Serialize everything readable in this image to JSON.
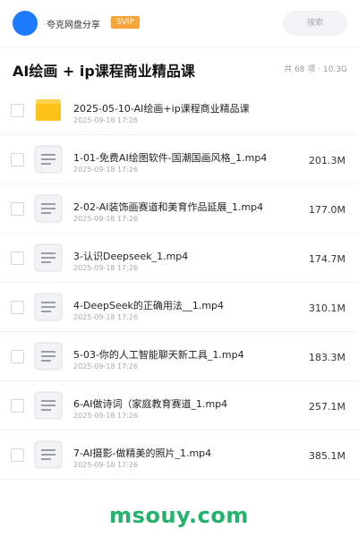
{
  "header": {
    "brand": "夸克网盘分享",
    "badge": "SVIP",
    "search_placeholder": "搜索"
  },
  "folder": {
    "title": "AI绘画 + ip课程商业精品课",
    "meta": "共 68 项 · 10.3G"
  },
  "files": [
    {
      "name": "2025-05-10-AI绘画+ip课程商业精品课",
      "date": "2025-09-18 17:26",
      "size": "",
      "type": "folder-icon"
    },
    {
      "name": "1-01-免费AI绘图软件-国潮国画风格_1.mp4",
      "date": "2025-09-18 17:26",
      "size": "201.3M",
      "type": "video-file-icon"
    },
    {
      "name": "2-02-AI装饰画赛道和美育作品延展_1.mp4",
      "date": "2025-09-18 17:26",
      "size": "177.0M",
      "type": "video-file-icon"
    },
    {
      "name": "3-认识Deepseek_1.mp4",
      "date": "2025-09-18 17:26",
      "size": "174.7M",
      "type": "video-file-icon"
    },
    {
      "name": "4-DeepSeek的正确用法__1.mp4",
      "date": "2025-09-18 17:26",
      "size": "310.1M",
      "type": "video-file-icon"
    },
    {
      "name": "5-03-你的人工智能聊天新工具_1.mp4",
      "date": "2025-09-18 17:26",
      "size": "183.3M",
      "type": "video-file-icon"
    },
    {
      "name": "6-AI做诗词（家庭教育赛道_1.mp4",
      "date": "2025-09-18 17:26",
      "size": "257.1M",
      "type": "video-file-icon"
    },
    {
      "name": "7-AI摄影-做精美的照片_1.mp4",
      "date": "2025-09-18 17:26",
      "size": "385.1M",
      "type": "video-file-icon"
    }
  ],
  "watermark": "msouy.com",
  "colors": {
    "accent": "#1e7bff",
    "badge": "#f7a53b",
    "folder": "#ffc83d",
    "watermark": "#22b26a"
  }
}
